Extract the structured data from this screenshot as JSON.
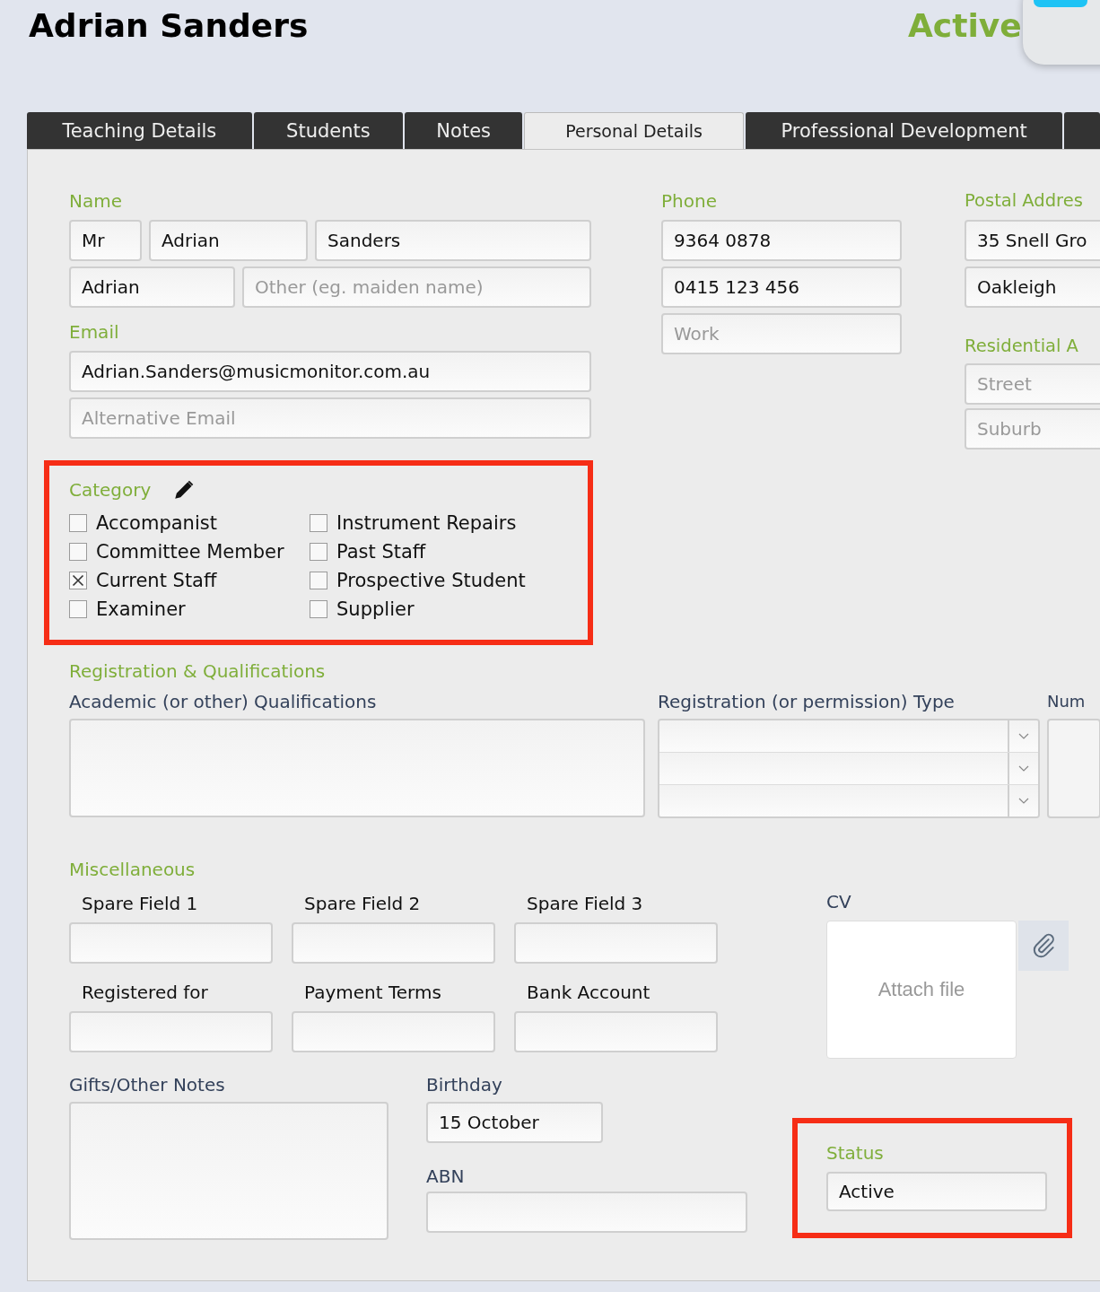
{
  "header": {
    "name": "Adrian Sanders",
    "status": "Active"
  },
  "tabs": [
    {
      "label": "Teaching Details",
      "selected": false
    },
    {
      "label": "Students",
      "selected": false
    },
    {
      "label": "Notes",
      "selected": false
    },
    {
      "label": "Personal Details",
      "selected": true
    },
    {
      "label": "Professional Development",
      "selected": false
    }
  ],
  "name_section": {
    "title": "Name",
    "fields": [
      {
        "value": "Mr"
      },
      {
        "value": "Adrian"
      },
      {
        "value": "Sanders"
      },
      {
        "value": "Adrian"
      },
      {
        "placeholder": "Other (eg. maiden name)"
      }
    ]
  },
  "email": {
    "title": "Email",
    "fields": [
      {
        "value": "Adrian.Sanders@musicmonitor.com.au"
      },
      {
        "placeholder": "Alternative Email"
      }
    ]
  },
  "phone": {
    "title": "Phone",
    "fields": [
      {
        "value": "9364 0878"
      },
      {
        "value": "0415 123 456"
      },
      {
        "placeholder": "Work"
      }
    ]
  },
  "postal_address": {
    "title": "Postal Addres",
    "fields": [
      {
        "value": "35 Snell Gro"
      },
      {
        "value": "Oakleigh"
      }
    ]
  },
  "residential_address": {
    "title": "Residential A",
    "fields": [
      {
        "placeholder": "Street"
      },
      {
        "placeholder": "Suburb"
      }
    ]
  },
  "category": {
    "title": "Category",
    "items": [
      {
        "label": "Accompanist",
        "checked": false
      },
      {
        "label": "Committee Member",
        "checked": false
      },
      {
        "label": "Current Staff",
        "checked": true
      },
      {
        "label": "Examiner",
        "checked": false
      },
      {
        "label": "Instrument Repairs",
        "checked": false
      },
      {
        "label": "Past Staff",
        "checked": false
      },
      {
        "label": "Prospective Student",
        "checked": false
      },
      {
        "label": "Supplier",
        "checked": false
      }
    ]
  },
  "registration": {
    "title": "Registration & Qualifications",
    "qualifications_label": "Academic (or other) Qualifications",
    "type_label": "Registration (or permission) Type",
    "column_3_label": "Num"
  },
  "miscellaneous": {
    "title": "Miscellaneous",
    "fields": [
      {
        "label": "Spare Field 1"
      },
      {
        "label": "Spare Field 2"
      },
      {
        "label": "Spare Field 3"
      },
      {
        "label": "Registered for"
      },
      {
        "label": "Payment Terms"
      },
      {
        "label": "Bank Account"
      }
    ],
    "cv": {
      "label": "CV",
      "placeholder": "Attach file"
    }
  },
  "notes": {
    "label": "Gifts/Other Notes"
  },
  "birthday": {
    "label": "Birthday",
    "value": "15 October"
  },
  "abn": {
    "label": "ABN"
  },
  "status": {
    "title": "Status",
    "value": "Active"
  }
}
